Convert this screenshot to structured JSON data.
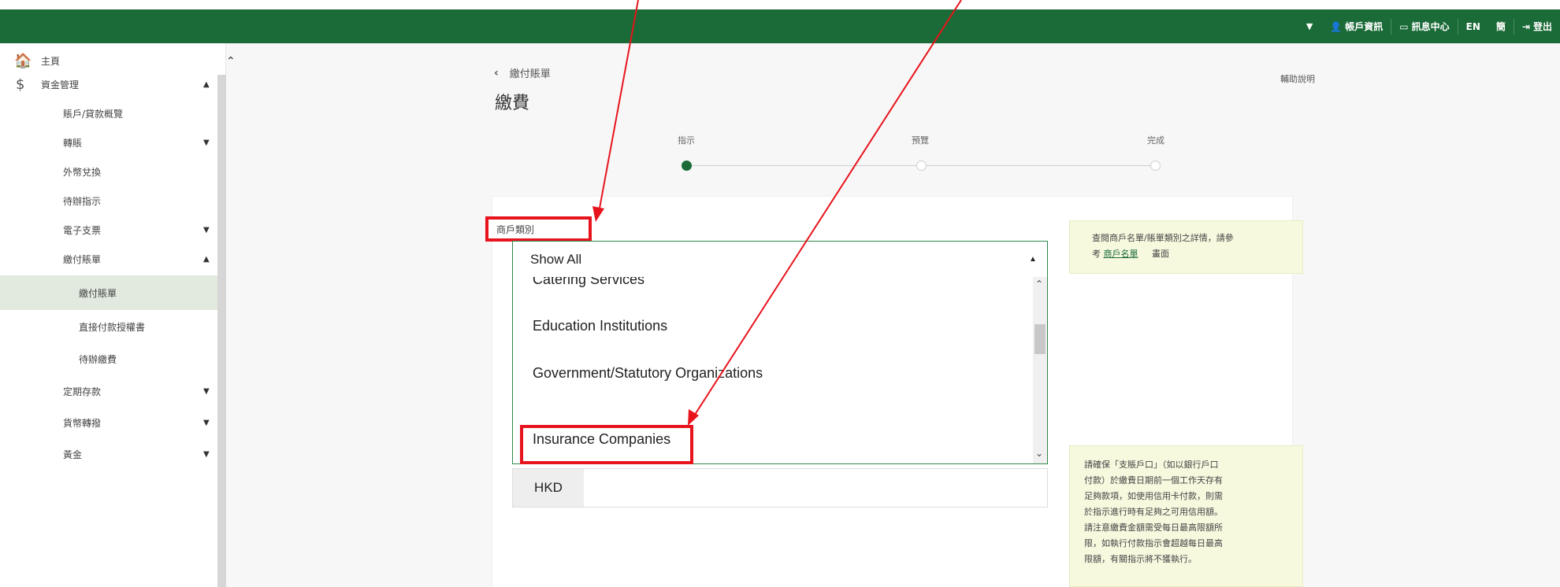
{
  "topbar": {
    "account": "帳戶資訊",
    "messages": "訊息中心",
    "lang_en": "EN",
    "lang_sc": "簡",
    "logout": "登出"
  },
  "sidebar": {
    "items": [
      {
        "label": "主頁"
      },
      {
        "label": "資金管理"
      },
      {
        "label": "賬戶/貸款概覽"
      },
      {
        "label": "轉賬"
      },
      {
        "label": "外幣兌換"
      },
      {
        "label": "待辦指示"
      },
      {
        "label": "電子支票"
      },
      {
        "label": "繳付賬單"
      },
      {
        "label": "繳付賬單"
      },
      {
        "label": "直接付款授權書"
      },
      {
        "label": "待辦繳費"
      },
      {
        "label": "定期存款"
      },
      {
        "label": "貨幣轉撥"
      },
      {
        "label": "黃金"
      }
    ]
  },
  "main": {
    "back_label": "繳付賬單",
    "title": "繳費",
    "help_label": "輔助說明",
    "steps": [
      "指示",
      "預覽",
      "完成"
    ],
    "field_label": "商戶類別",
    "select": {
      "value": "Show All",
      "options": [
        "Catering Services",
        "Education Institutions",
        "Government/Statutory Organizations",
        "Insurance Companies"
      ]
    },
    "currency": "HKD",
    "note1": {
      "line1": "查閱商戶名單/賬單類別之詳情，請參",
      "line2_pre": "考",
      "link": "商戶名單",
      "line2_post": "畫面"
    },
    "note2": [
      "請確保「支賬戶口」（如以銀行戶口",
      "付款）於繳費日期前一個工作天存有",
      "足夠款項，如使用信用卡付款，則需",
      "於指示進行時有足夠之可用信用額。",
      "請注意繳費金額需受每日最高限額所",
      "限，如執行付款指示會超越每日最高",
      "限額，有關指示將不獲執行。"
    ]
  },
  "colors": {
    "brand_green": "#1a6b37",
    "annotation_red": "#e8141d"
  }
}
